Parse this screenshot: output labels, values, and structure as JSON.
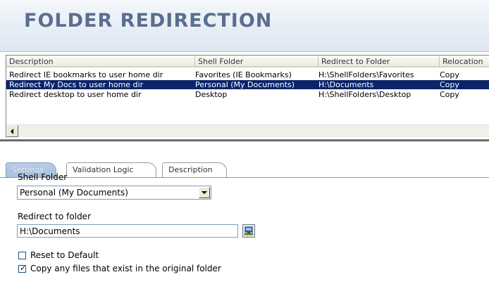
{
  "header": {
    "title": "FOLDER REDIRECTION"
  },
  "list": {
    "columns": [
      "Description",
      "Shell Folder",
      "Redirect to Folder",
      "Relocation"
    ],
    "rows": [
      {
        "description": "Redirect IE bookmarks to user home dir",
        "shell_folder": "Favorites (IE Bookmarks)",
        "redirect": "H:\\ShellFolders\\Favorites",
        "relocation": "Copy"
      },
      {
        "description": "Redirect My Docs to user home dir",
        "shell_folder": "Personal (My Documents)",
        "redirect": "H:\\Documents",
        "relocation": "Copy"
      },
      {
        "description": "Redirect desktop to user home dir",
        "shell_folder": "Desktop",
        "redirect": "H:\\ShellFolders\\Desktop",
        "relocation": "Copy"
      }
    ],
    "selected_row": 1
  },
  "tabs": [
    {
      "label": "Settings",
      "active": true
    },
    {
      "label": "Validation Logic",
      "active": false
    },
    {
      "label": "Description",
      "active": false
    }
  ],
  "settings": {
    "shell_folder_label": "Shell Folder",
    "shell_folder_value": "Personal (My Documents)",
    "redirect_label": "Redirect to folder",
    "redirect_value": "H:\\Documents",
    "reset_label": "Reset to Default",
    "reset_checked": false,
    "copy_label": "Copy any files that exist in the original folder",
    "copy_checked": true
  },
  "icons": {
    "browse": "folder-browse-icon",
    "scroll_left": "arrow-left-icon",
    "dropdown": "chevron-down-icon"
  },
  "colors": {
    "header_title": "#5a6f8f",
    "selection": "#0a246a",
    "active_tab": "#a8c0e0"
  }
}
